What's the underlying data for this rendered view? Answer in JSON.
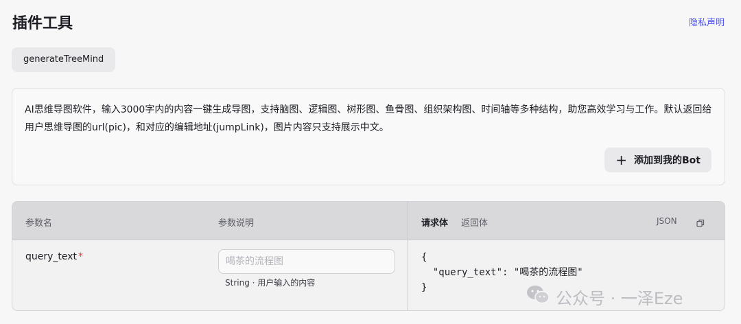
{
  "header": {
    "title": "插件工具",
    "privacy_link": "隐私声明"
  },
  "tool": {
    "name": "generateTreeMind"
  },
  "description": {
    "text": "AI思维导图软件，输入3000字内的内容一键生成导图，支持脑图、逻辑图、树形图、鱼骨图、组织架构图、时间轴等多种结构，助您高效学习与工作。默认返回给用户思维导图的url(pic)，和对应的编辑地址(jumpLink)，图片内容只支持展示中文。",
    "add_button_label": "添加到我的Bot"
  },
  "params": {
    "col_name": "参数名",
    "col_desc": "参数说明",
    "tab_request": "请求体",
    "tab_response": "返回体",
    "format_label": "JSON",
    "rows": [
      {
        "name": "query_text",
        "required_mark": "*",
        "placeholder": "喝茶的流程图",
        "type_desc": "String · 用户输入的内容"
      }
    ],
    "json_preview": "{\n  \"query_text\": \"喝茶的流程图\"\n}"
  },
  "watermark": {
    "text": "公众号 · 一泽Eze"
  },
  "colors": {
    "accent": "#4d53e8",
    "required": "#e53935"
  }
}
